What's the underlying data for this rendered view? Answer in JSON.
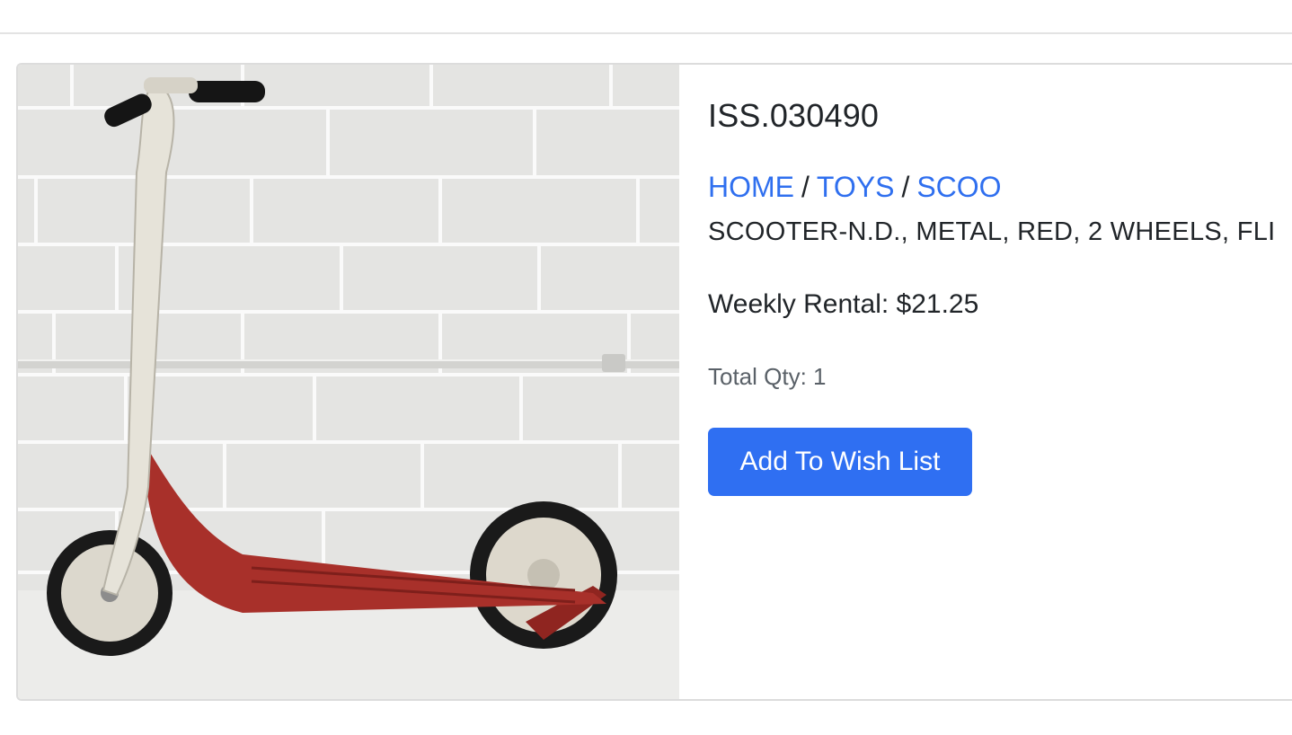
{
  "product": {
    "sku": "ISS.030490",
    "breadcrumb": [
      {
        "label": "HOME"
      },
      {
        "label": "TOYS"
      },
      {
        "label": "SCOO"
      }
    ],
    "breadcrumb_separator": "/",
    "description": "SCOOTER-N.D., METAL, RED, 2 WHEELS, FLI",
    "weekly_rental": "Weekly Rental: $21.25",
    "total_qty": "Total Qty: 1",
    "wish_button_label": "Add To Wish List",
    "image_alt": "ISS.030490"
  },
  "colors": {
    "link": "#2f6fef",
    "button": "#2f6ff2",
    "scooter_deck": "#a8302a",
    "scooter_stem": "#e6e3d9"
  }
}
